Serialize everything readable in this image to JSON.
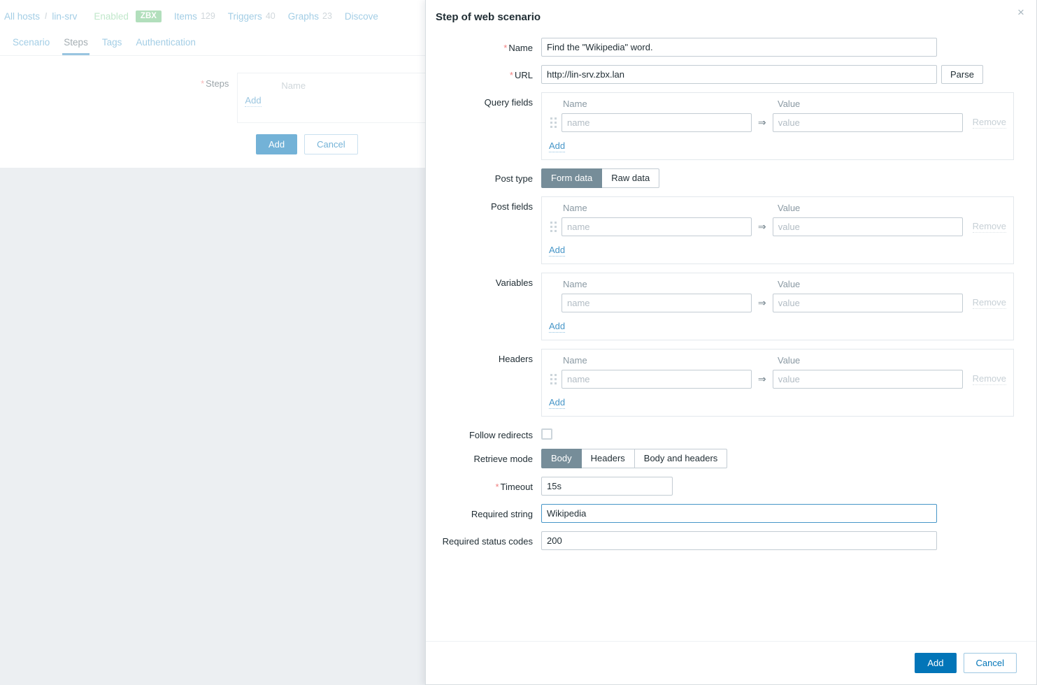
{
  "background": {
    "breadcrumb": {
      "all_hosts": "All hosts",
      "separator": "/",
      "host": "lin-srv",
      "status": "Enabled",
      "agent_badge": "ZBX",
      "items_label": "Items",
      "items_count": "129",
      "triggers_label": "Triggers",
      "triggers_count": "40",
      "graphs_label": "Graphs",
      "graphs_count": "23",
      "discovery_label": "Discove"
    },
    "tabs": [
      {
        "label": "Scenario",
        "active": false
      },
      {
        "label": "Steps",
        "active": true
      },
      {
        "label": "Tags",
        "active": false
      },
      {
        "label": "Authentication",
        "active": false
      }
    ],
    "steps_form": {
      "label": "Steps",
      "required": "*",
      "column_name": "Name",
      "add_link": "Add"
    },
    "buttons": {
      "add": "Add",
      "cancel": "Cancel"
    }
  },
  "modal": {
    "title": "Step of web scenario",
    "close_icon": "×",
    "fields": {
      "name": {
        "label": "Name",
        "required": "*",
        "value": "Find the \"Wikipedia\" word."
      },
      "url": {
        "label": "URL",
        "required": "*",
        "value": "http://lin-srv.zbx.lan",
        "parse_button": "Parse"
      },
      "query_fields": {
        "label": "Query fields",
        "col_name": "Name",
        "col_value": "Value",
        "name_placeholder": "name",
        "value_placeholder": "value",
        "arrow": "⇒",
        "remove_link": "Remove",
        "add_link": "Add",
        "has_drag_handle": true
      },
      "post_type": {
        "label": "Post type",
        "options": [
          "Form data",
          "Raw data"
        ],
        "selected": "Form data"
      },
      "post_fields": {
        "label": "Post fields",
        "col_name": "Name",
        "col_value": "Value",
        "name_placeholder": "name",
        "value_placeholder": "value",
        "arrow": "⇒",
        "remove_link": "Remove",
        "add_link": "Add",
        "has_drag_handle": true
      },
      "variables": {
        "label": "Variables",
        "col_name": "Name",
        "col_value": "Value",
        "name_placeholder": "name",
        "value_placeholder": "value",
        "arrow": "⇒",
        "remove_link": "Remove",
        "add_link": "Add",
        "has_drag_handle": false
      },
      "headers": {
        "label": "Headers",
        "col_name": "Name",
        "col_value": "Value",
        "name_placeholder": "name",
        "value_placeholder": "value",
        "arrow": "⇒",
        "remove_link": "Remove",
        "add_link": "Add",
        "has_drag_handle": true
      },
      "follow_redirects": {
        "label": "Follow redirects",
        "checked": false
      },
      "retrieve_mode": {
        "label": "Retrieve mode",
        "options": [
          "Body",
          "Headers",
          "Body and headers"
        ],
        "selected": "Body"
      },
      "timeout": {
        "label": "Timeout",
        "required": "*",
        "value": "15s"
      },
      "required_string": {
        "label": "Required string",
        "value": "Wikipedia",
        "focused": true
      },
      "required_status_codes": {
        "label": "Required status codes",
        "value": "200"
      }
    },
    "footer": {
      "add": "Add",
      "cancel": "Cancel"
    }
  },
  "colors": {
    "accent_blue": "#0275b8",
    "link_blue": "#4796c8",
    "badge_green": "#74c686",
    "segment_selected": "#768d99",
    "required_star": "#f07f7f",
    "page_bg": "#eceff2"
  }
}
